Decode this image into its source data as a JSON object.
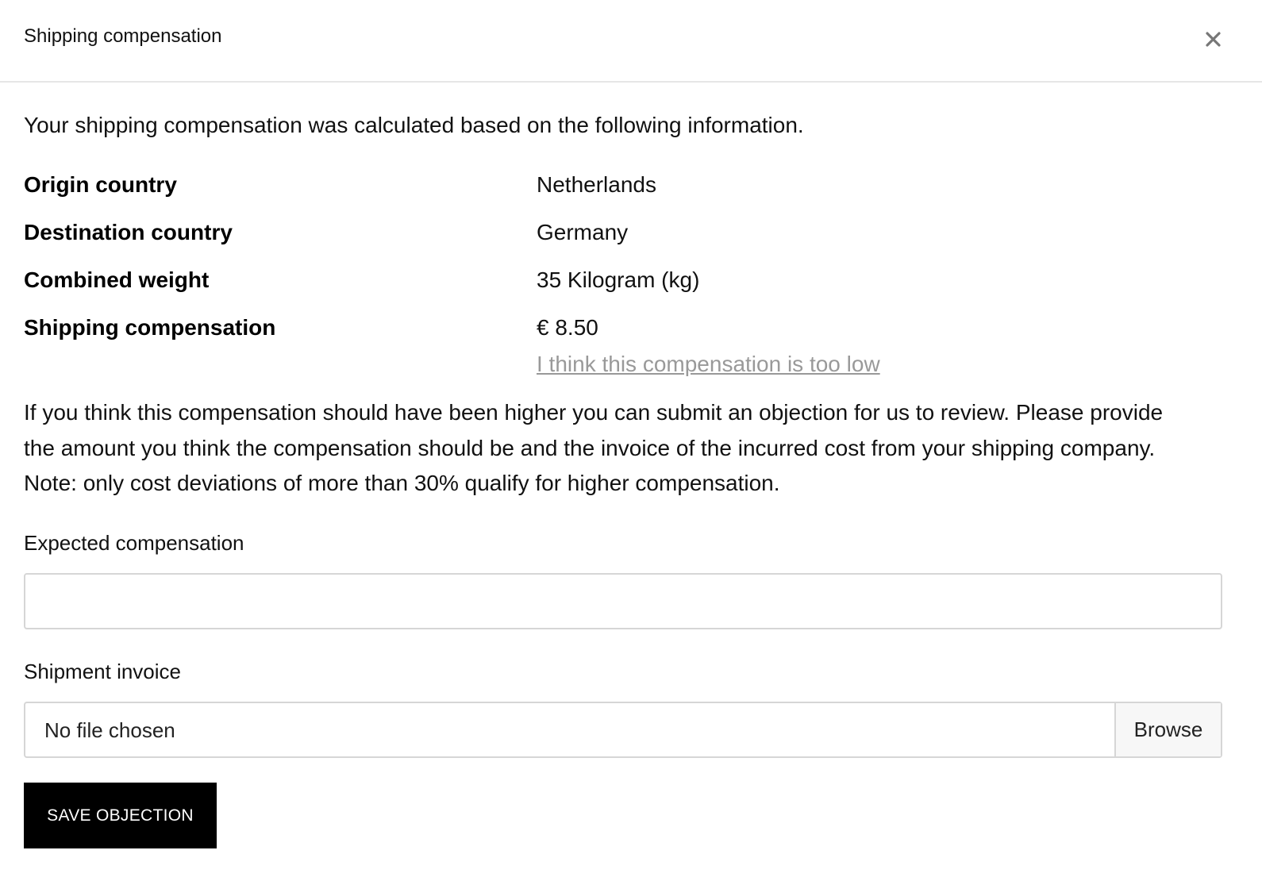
{
  "modal": {
    "title": "Shipping compensation",
    "close_icon": "close-icon"
  },
  "intro": "Your shipping compensation was calculated based on the following information.",
  "info": [
    {
      "label": "Origin country",
      "value": "Netherlands"
    },
    {
      "label": "Destination country",
      "value": "Germany"
    },
    {
      "label": "Combined weight",
      "value": "35 Kilogram (kg)"
    },
    {
      "label": "Shipping compensation",
      "value": "€ 8.50"
    }
  ],
  "objection_link": "I think this compensation is too low",
  "explanation": {
    "line1": "If you think this compensation should have been higher you can submit an objection for us to review. Please provide",
    "line2": "the amount you think the compensation should be and the invoice of the incurred cost from your shipping company.",
    "line3": "Note: only cost deviations of more than 30% qualify for higher compensation."
  },
  "form": {
    "expected_label": "Expected compensation",
    "expected_value": "",
    "invoice_label": "Shipment invoice",
    "file_status": "No file chosen",
    "browse_label": "Browse",
    "save_label": "SAVE OBJECTION"
  },
  "colors": {
    "link": "#999999",
    "button_bg": "#000000",
    "button_text": "#ffffff",
    "border": "#d6d6d6"
  }
}
